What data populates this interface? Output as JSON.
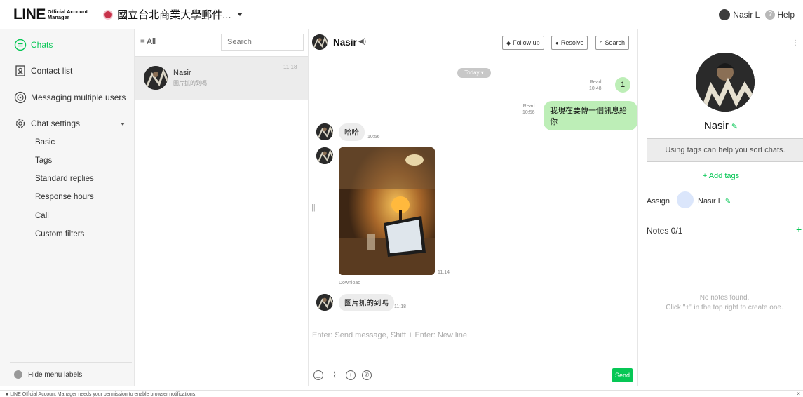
{
  "header": {
    "brand_main": "LINE",
    "brand_sub_1": "Official Account",
    "brand_sub_2": "Manager",
    "account_name": "國立台北商業大學郵件...",
    "user_name": "Nasir L",
    "help_label": "Help"
  },
  "sidebar": {
    "items": [
      {
        "label": "Chats",
        "icon": "chat-bubble-icon",
        "active": true
      },
      {
        "label": "Contact list",
        "icon": "contact-list-icon"
      },
      {
        "label": "Messaging multiple users",
        "icon": "broadcast-icon"
      },
      {
        "label": "Chat settings",
        "icon": "gear-icon"
      }
    ],
    "sub_items": [
      "Basic",
      "Tags",
      "Standard replies",
      "Response hours",
      "Call",
      "Custom filters"
    ],
    "hide_labels": "Hide menu labels"
  },
  "chat_list": {
    "filter_label": "≡ All",
    "search_placeholder": "Search",
    "rows": [
      {
        "name": "Nasir",
        "preview": "圖片抓的到嗎",
        "time": "11:18"
      }
    ]
  },
  "chat_room": {
    "name": "Nasir",
    "speaker_glyph": "◀)",
    "buttons": {
      "follow_up": "Follow up",
      "resolve": "Resolve",
      "search": "Search"
    },
    "date_chip": "Today ▾",
    "messages": [
      {
        "from": "me",
        "text": "1",
        "read": "Read",
        "time": "10:48"
      },
      {
        "from": "me",
        "text": "我現在要傳一個訊息給你",
        "read": "Read",
        "time": "10:56"
      },
      {
        "from": "them",
        "text": "哈哈",
        "time": "10:56"
      },
      {
        "from": "them",
        "type": "image",
        "time": "11:14",
        "download": "Download"
      },
      {
        "from": "them",
        "text": "圖片抓的到嗎",
        "time": "11:18"
      }
    ],
    "composer_placeholder": "Enter: Send message, Shift + Enter: New line",
    "send_label": "Send"
  },
  "right_panel": {
    "name": "Nasir",
    "tag_hint": "Using tags can help you sort chats.",
    "add_tags": "+ Add tags",
    "assign_label": "Assign",
    "assignee": "Nasir L",
    "notes_title": "Notes 0/1",
    "no_notes_line1": "No notes found.",
    "no_notes_line2": "Click \"+\" in the top right to create one."
  },
  "notification": {
    "text": "LINE Official Account Manager needs your permission to enable browser notifications."
  },
  "colors": {
    "accent": "#06c755",
    "my_bubble": "#bdeeb7",
    "their_bubble": "#ececec"
  }
}
